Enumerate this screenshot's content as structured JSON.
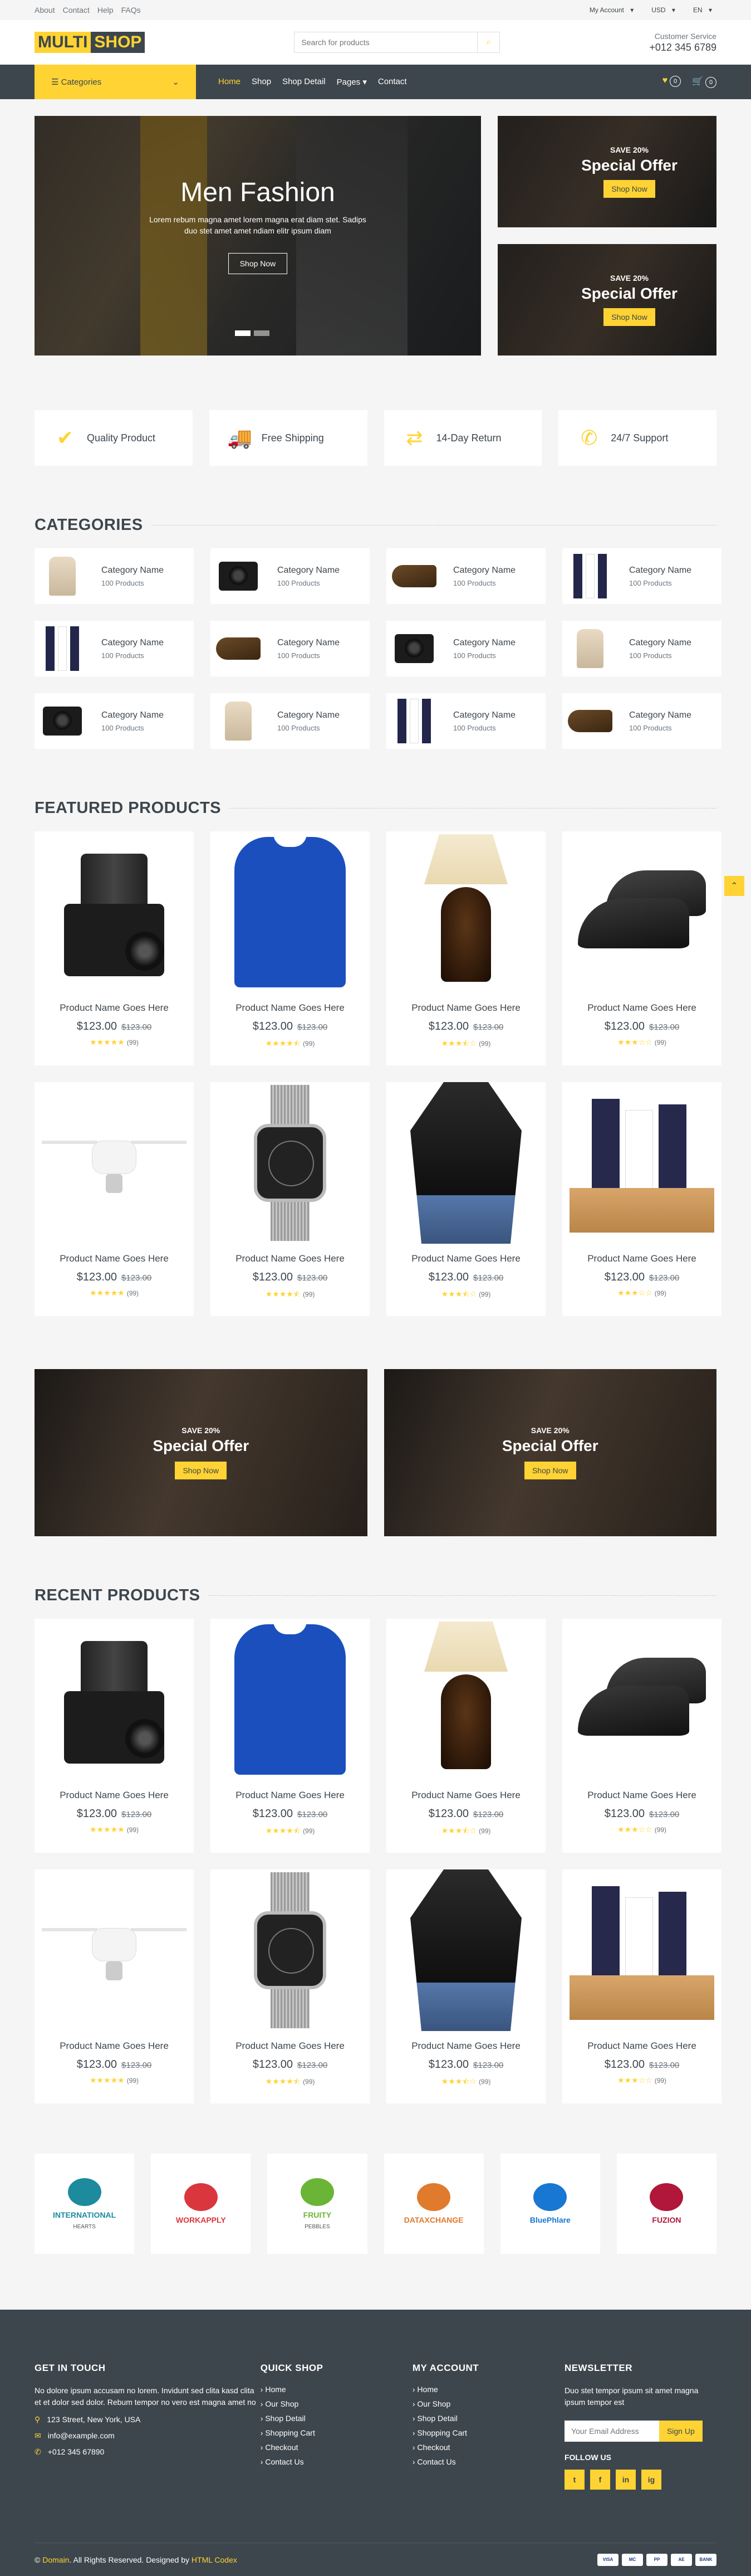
{
  "topbar": {
    "links": [
      "About",
      "Contact",
      "Help",
      "FAQs"
    ],
    "my_account": "My Account",
    "currency": "USD",
    "language": "EN"
  },
  "header": {
    "logo_part1": "MULTI",
    "logo_part2": "SHOP",
    "search_placeholder": "Search for products",
    "customer_service_label": "Customer Service",
    "customer_service_phone": "+012 345 6789"
  },
  "nav": {
    "categories_label": "Categories",
    "links": [
      "Home",
      "Shop",
      "Shop Detail",
      "Pages",
      "Contact"
    ],
    "wishlist_count": "0",
    "cart_count": "0"
  },
  "hero": {
    "title": "Men Fashion",
    "text": "Lorem rebum magna amet lorem magna erat diam stet. Sadips duo stet amet amet ndiam elitr ipsum diam",
    "button": "Shop Now"
  },
  "offers": [
    {
      "save": "SAVE 20%",
      "title": "Special Offer",
      "button": "Shop Now"
    },
    {
      "save": "SAVE 20%",
      "title": "Special Offer",
      "button": "Shop Now"
    }
  ],
  "features": [
    {
      "icon": "check-icon",
      "glyph": "✔",
      "label": "Quality Product"
    },
    {
      "icon": "shipping-icon",
      "glyph": "🚚",
      "label": "Free Shipping"
    },
    {
      "icon": "exchange-icon",
      "glyph": "⇄",
      "label": "14-Day Return"
    },
    {
      "icon": "phone-icon",
      "glyph": "✆",
      "label": "24/7 Support"
    }
  ],
  "categories_title": "CATEGORIES",
  "categories": [
    {
      "img": "shirt",
      "name": "Category Name",
      "count": "100 Products"
    },
    {
      "img": "cam",
      "name": "Category Name",
      "count": "100 Products"
    },
    {
      "img": "shoe",
      "name": "Category Name",
      "count": "100 Products"
    },
    {
      "img": "tube",
      "name": "Category Name",
      "count": "100 Products"
    },
    {
      "img": "tube",
      "name": "Category Name",
      "count": "100 Products"
    },
    {
      "img": "shoe",
      "name": "Category Name",
      "count": "100 Products"
    },
    {
      "img": "cam",
      "name": "Category Name",
      "count": "100 Products"
    },
    {
      "img": "shirt",
      "name": "Category Name",
      "count": "100 Products"
    },
    {
      "img": "cam",
      "name": "Category Name",
      "count": "100 Products"
    },
    {
      "img": "shirt",
      "name": "Category Name",
      "count": "100 Products"
    },
    {
      "img": "tube",
      "name": "Category Name",
      "count": "100 Products"
    },
    {
      "img": "shoe",
      "name": "Category Name",
      "count": "100 Products"
    }
  ],
  "featured_title": "FEATURED PRODUCTS",
  "recent_title": "RECENT PRODUCTS",
  "products": [
    {
      "img": "camera",
      "name": "Product Name Goes Here",
      "price": "$123.00",
      "old_price": "$123.00",
      "rating": 5,
      "reviews": "(99)"
    },
    {
      "img": "sweater",
      "name": "Product Name Goes Here",
      "price": "$123.00",
      "old_price": "$123.00",
      "rating": 4.5,
      "reviews": "(99)"
    },
    {
      "img": "lamp",
      "name": "Product Name Goes Here",
      "price": "$123.00",
      "old_price": "$123.00",
      "rating": 3.5,
      "reviews": "(99)"
    },
    {
      "img": "shoes",
      "name": "Product Name Goes Here",
      "price": "$123.00",
      "old_price": "$123.00",
      "rating": 3,
      "reviews": "(99)"
    },
    {
      "img": "drone",
      "name": "Product Name Goes Here",
      "price": "$123.00",
      "old_price": "$123.00",
      "rating": 5,
      "reviews": "(99)"
    },
    {
      "img": "watch",
      "name": "Product Name Goes Here",
      "price": "$123.00",
      "old_price": "$123.00",
      "rating": 4.5,
      "reviews": "(99)"
    },
    {
      "img": "blouse",
      "name": "Product Name Goes Here",
      "price": "$123.00",
      "old_price": "$123.00",
      "rating": 3.5,
      "reviews": "(99)"
    },
    {
      "img": "cosmetics",
      "name": "Product Name Goes Here",
      "price": "$123.00",
      "old_price": "$123.00",
      "rating": 3,
      "reviews": "(99)"
    }
  ],
  "banners": [
    {
      "save": "SAVE 20%",
      "title": "Special Offer",
      "button": "Shop Now"
    },
    {
      "save": "SAVE 20%",
      "title": "Special Offer",
      "button": "Shop Now"
    }
  ],
  "vendors": [
    {
      "name": "INTERNATIONAL",
      "sub": "HEARTS",
      "color": "#1d8a9e"
    },
    {
      "name": "WORKAPPLY",
      "sub": "",
      "color": "#d9363e"
    },
    {
      "name": "FRUITY",
      "sub": "PEBBLES",
      "color": "#6bb536"
    },
    {
      "name": "DATAXCHANGE",
      "sub": "",
      "color": "#e07a2c"
    },
    {
      "name": "BluePhlare",
      "sub": "",
      "color": "#1877d2"
    },
    {
      "name": "FUZION",
      "sub": "",
      "color": "#b0173a"
    }
  ],
  "footer": {
    "touch_title": "GET IN TOUCH",
    "touch_text": "No dolore ipsum accusam no lorem. Invidunt sed clita kasd clita et et dolor sed dolor. Rebum tempor no vero est magna amet no",
    "address": "123 Street, New York, USA",
    "email": "info@example.com",
    "phone": "+012 345 67890",
    "quick_title": "QUICK SHOP",
    "quick_links": [
      "Home",
      "Our Shop",
      "Shop Detail",
      "Shopping Cart",
      "Checkout",
      "Contact Us"
    ],
    "account_title": "MY ACCOUNT",
    "account_links": [
      "Home",
      "Our Shop",
      "Shop Detail",
      "Shopping Cart",
      "Checkout",
      "Contact Us"
    ],
    "newsletter_title": "NEWSLETTER",
    "newsletter_text": "Duo stet tempor ipsum sit amet magna ipsum tempor est",
    "email_placeholder": "Your Email Address",
    "signup_button": "Sign Up",
    "follow_title": "FOLLOW US",
    "socials": [
      "t",
      "f",
      "in",
      "ig"
    ],
    "copyright_prefix": "©",
    "copyright_domain": "Domain",
    "copyright_mid": ". All Rights Reserved. Designed by",
    "copyright_designer": "HTML Codex",
    "payments": [
      "VISA",
      "MC",
      "PP",
      "AE",
      "BANK"
    ]
  },
  "colors": {
    "accent": "#ffd333",
    "dark": "#3d464d",
    "bg": "#f5f5f5"
  }
}
